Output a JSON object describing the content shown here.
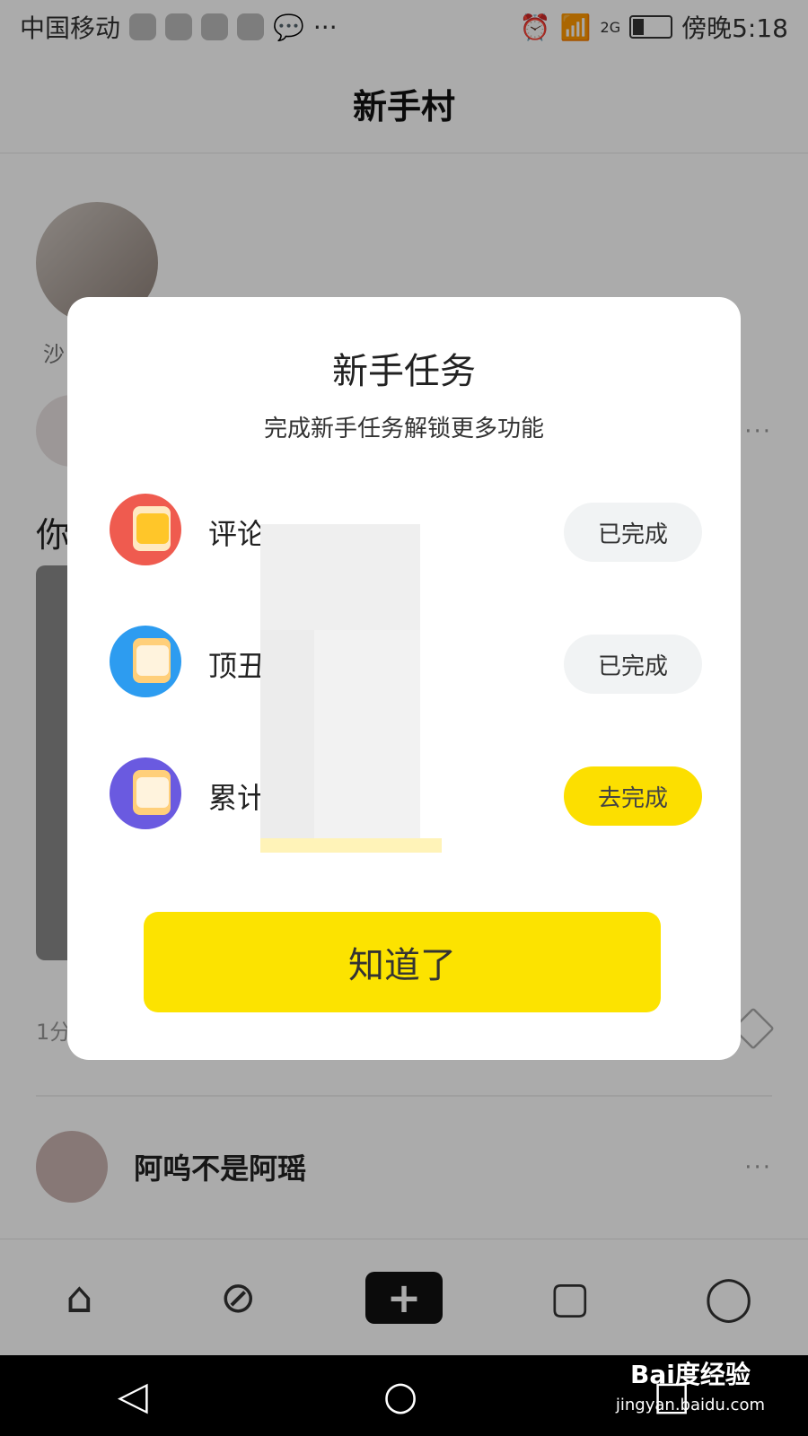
{
  "status_bar": {
    "carrier": "中国移动",
    "more": "···",
    "signal_label": "2G",
    "time": "傍晚5:18"
  },
  "header": {
    "title": "新手村"
  },
  "background": {
    "profile_name": "沙",
    "feed_title": "你",
    "feed_time": "1分",
    "second_post_name": "阿呜不是阿瑶",
    "more_icon": "···"
  },
  "modal": {
    "title": "新手任务",
    "subtitle": "完成新手任务解锁更多功能",
    "tasks": [
      {
        "label": "评论",
        "button": "已完成",
        "status": "done"
      },
      {
        "label": "顶丑",
        "button": "已完成",
        "status": "done"
      },
      {
        "label": "累计",
        "button": "去完成",
        "status": "todo"
      }
    ],
    "confirm_label": "知道了"
  },
  "tab_bar": {
    "tabs": [
      "home-icon",
      "discover-compass-icon",
      "add-icon",
      "message-icon",
      "profile-icon"
    ]
  },
  "system_nav": {
    "watermark_main": "Bai度经验",
    "watermark_url": "jingyan.baidu.com"
  },
  "colors": {
    "accent_yellow": "#fce300",
    "done_gray": "#f1f3f4"
  }
}
